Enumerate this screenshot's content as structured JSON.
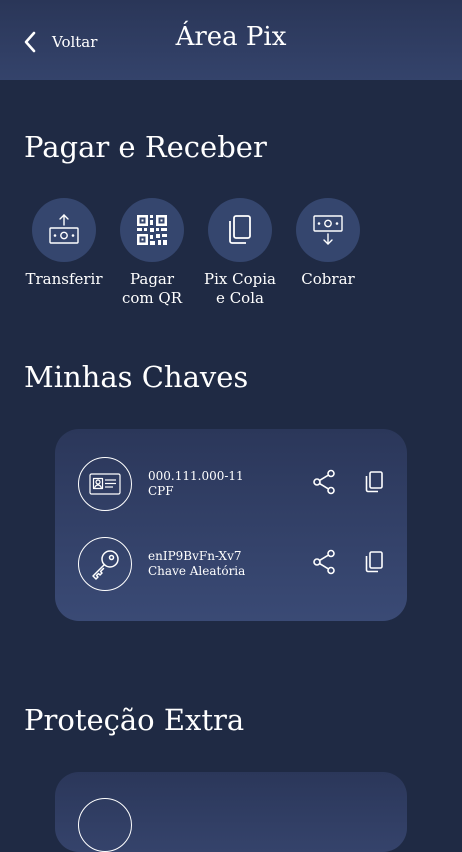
{
  "header": {
    "back_label": "Voltar",
    "title": "Área Pix"
  },
  "sections": {
    "pay_receive": "Pagar e Receber",
    "my_keys": "Minhas Chaves",
    "extra_protection": "Proteção Extra"
  },
  "actions": [
    {
      "label": "Transferir",
      "icon": "transfer-icon"
    },
    {
      "label": "Pagar com QR",
      "icon": "qr-code-icon"
    },
    {
      "label": "Pix Copia e Cola",
      "icon": "copy-paste-icon"
    },
    {
      "label": "Cobrar",
      "icon": "charge-icon"
    }
  ],
  "keys": [
    {
      "value": "000.111.000-11",
      "type": "CPF",
      "icon": "id-card-icon"
    },
    {
      "value": "enIP9BvFn-Xv7",
      "type": "Chave Aleatória",
      "icon": "key-icon"
    }
  ],
  "colors": {
    "background": "#1f2a44",
    "header": "#2f3d63",
    "action_circle": "#35466e",
    "card": "#34436b"
  }
}
